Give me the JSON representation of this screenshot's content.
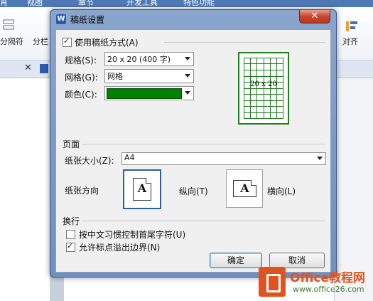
{
  "app": {
    "topbar_items": [
      "肖",
      "视图",
      "章节",
      "开发工具",
      "特色功能"
    ],
    "ribbon_left_label": "分隔符",
    "ribbon_left_label2": "分栏",
    "ribbon_right_label": "对齐"
  },
  "dialog": {
    "title": "稿纸设置",
    "app_icon": "W",
    "close_symbol": "✕",
    "use_grid_label": "使用稿纸方式(A)",
    "use_grid_checked": true,
    "spec_label": "规格(S):",
    "spec_value": "20 x 20 (400 字)",
    "grid_label": "网格(G):",
    "grid_value": "网格",
    "color_label": "颜色(C):",
    "color_value": "#008000",
    "preview_caption": "20 x 20",
    "page_section": "页面",
    "paper_size_label": "纸张大小(Z):",
    "paper_size_value": "A4",
    "orientation_label": "纸张方向",
    "portrait_label": "纵向(T)",
    "landscape_label": "横向(L)",
    "portrait_selected": true,
    "orientation_letter": "A",
    "wrap_section": "换行",
    "cjk_control_label": "按中文习惯控制首尾字符(U)",
    "cjk_control_checked": false,
    "allow_punct_label": "允许标点溢出边界(N)",
    "allow_punct_checked": true,
    "ok_label": "确定",
    "cancel_label": "取消"
  },
  "watermark": {
    "brand": "Office教程网",
    "url": "www.office26.com"
  }
}
